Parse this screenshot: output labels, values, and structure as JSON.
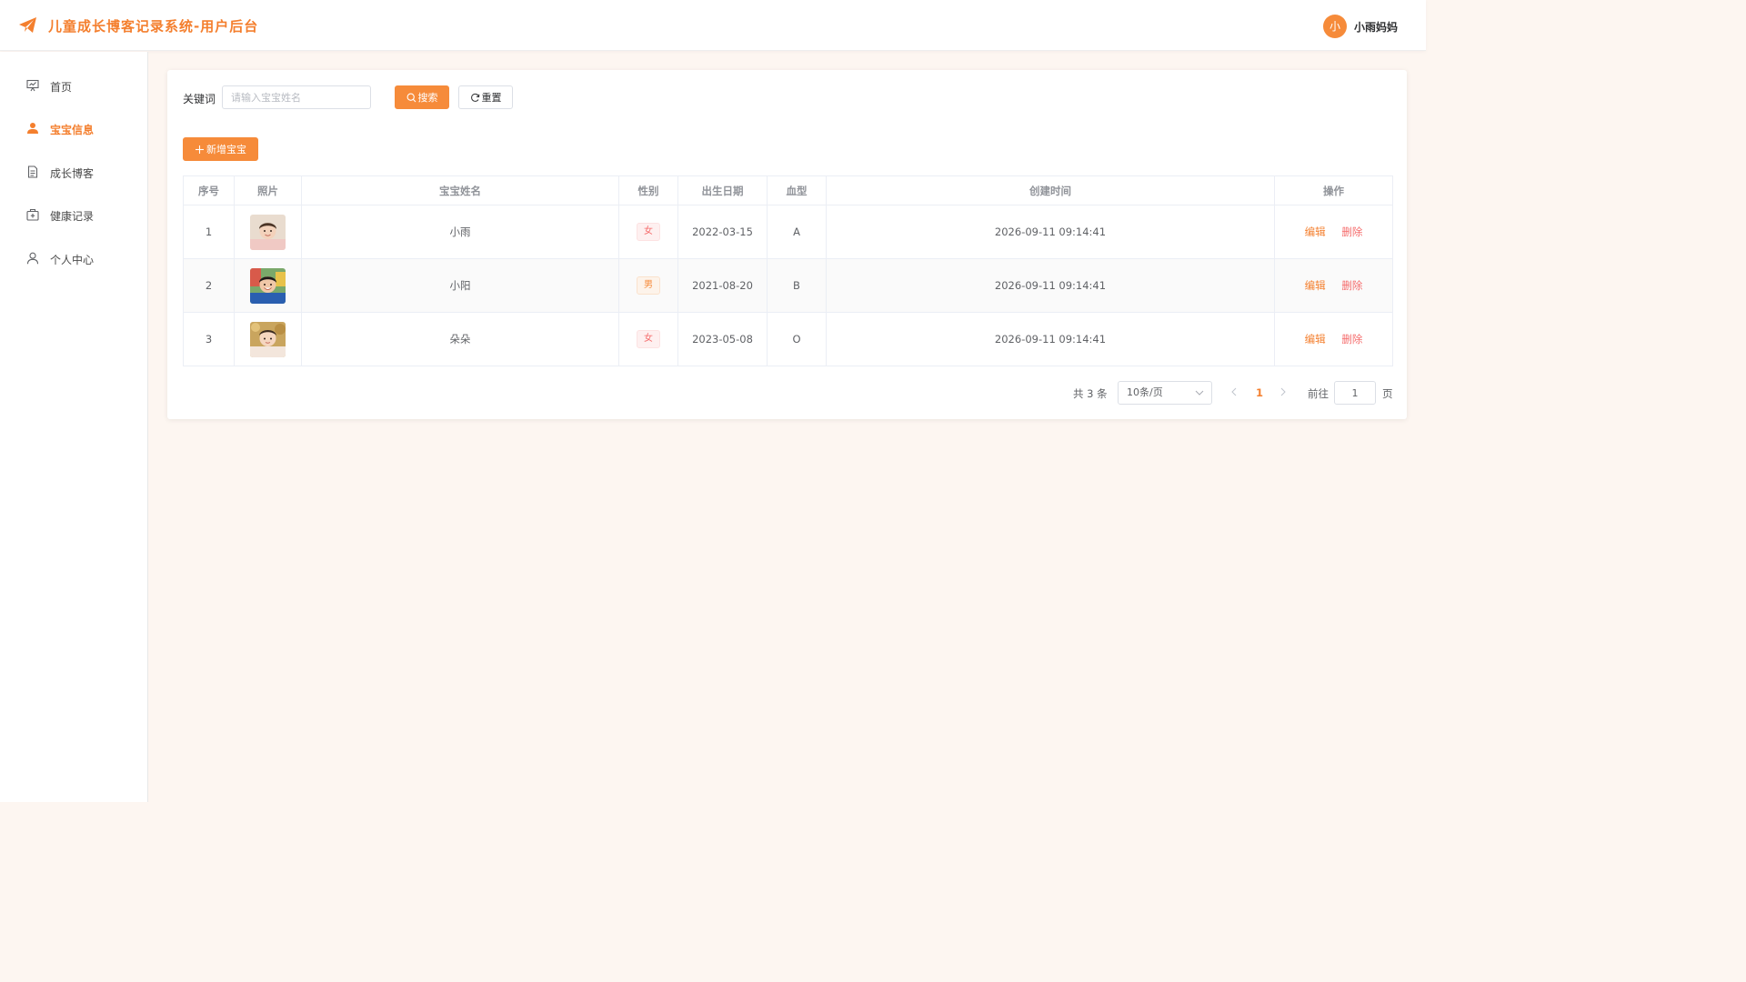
{
  "header": {
    "title": "儿童成长博客记录系统-用户后台",
    "avatar_text": "小",
    "username": "小雨妈妈"
  },
  "sidebar": {
    "items": [
      {
        "label": "首页",
        "icon": "presentation-icon"
      },
      {
        "label": "宝宝信息",
        "icon": "user-icon",
        "active": true
      },
      {
        "label": "成长博客",
        "icon": "document-icon"
      },
      {
        "label": "健康记录",
        "icon": "medical-kit-icon"
      },
      {
        "label": "个人中心",
        "icon": "person-outline-icon"
      }
    ]
  },
  "search": {
    "label": "关键词",
    "placeholder": "请输入宝宝姓名",
    "value": "",
    "search_button": "搜索",
    "reset_button": "重置"
  },
  "toolbar": {
    "add_button": "新增宝宝"
  },
  "table": {
    "columns": [
      "序号",
      "照片",
      "宝宝姓名",
      "性别",
      "出生日期",
      "血型",
      "创建时间",
      "操作"
    ],
    "rows": [
      {
        "index": "1",
        "name": "小雨",
        "gender": "女",
        "birth": "2022-03-15",
        "blood": "A",
        "created": "2026-09-11 09:14:41"
      },
      {
        "index": "2",
        "name": "小阳",
        "gender": "男",
        "birth": "2021-08-20",
        "blood": "B",
        "created": "2026-09-11 09:14:41"
      },
      {
        "index": "3",
        "name": "朵朵",
        "gender": "女",
        "birth": "2023-05-08",
        "blood": "O",
        "created": "2026-09-11 09:14:41"
      }
    ],
    "edit_label": "编辑",
    "delete_label": "删除"
  },
  "pagination": {
    "total": "共 3 条",
    "page_size": "10条/页",
    "current_page": "1",
    "goto_label": "前往",
    "goto_value": "1",
    "unit": "页"
  },
  "colors": {
    "accent": "#f68b3a",
    "title": "#f47f2e",
    "danger": "#f56c6c",
    "background": "#fdf6f1"
  }
}
